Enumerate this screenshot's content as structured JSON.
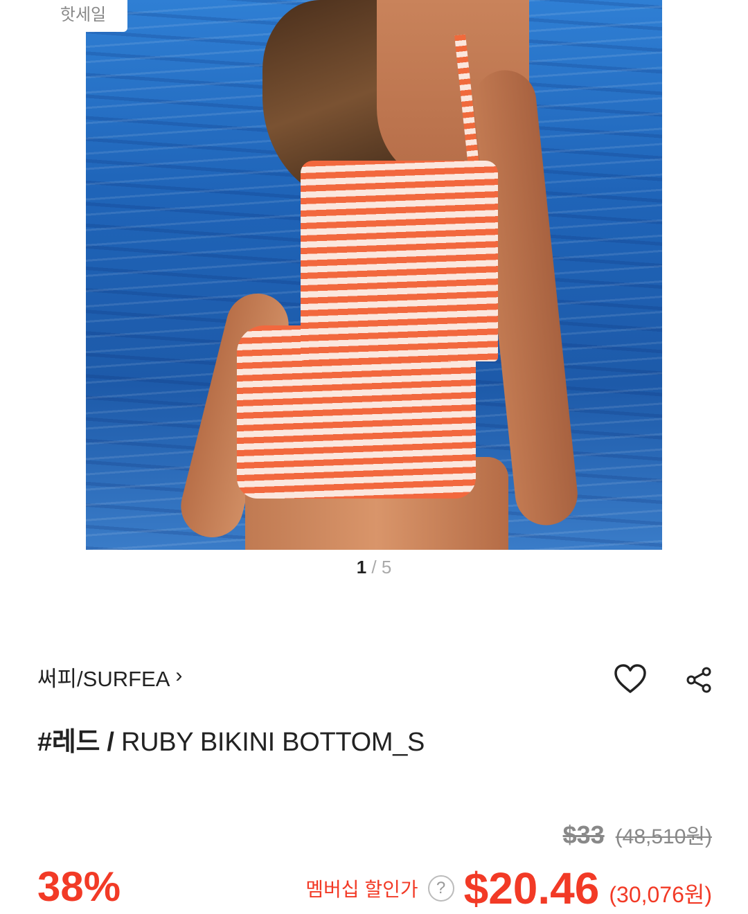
{
  "image": {
    "badge_label": "핫세일",
    "pager": {
      "current": "1",
      "separator": " / ",
      "total": "5"
    }
  },
  "product": {
    "brand": "써피/SURFEA",
    "brand_chevron": "›",
    "title_tag": "#레드 / ",
    "title_name": "RUBY BIKINI BOTTOM_S",
    "original_price_usd": "$33",
    "original_price_krw": "(48,510원)",
    "discount_percent": "38%",
    "member_label": "멤버십 할인가",
    "help_mark": "?",
    "sale_price_usd": "$20.46",
    "sale_price_krw": "(30,076원)"
  },
  "icons": {
    "wishlist": "heart-outline-icon",
    "share": "share-icon"
  },
  "colors": {
    "accent": "#f23a26",
    "muted": "#888888",
    "text": "#222222"
  }
}
